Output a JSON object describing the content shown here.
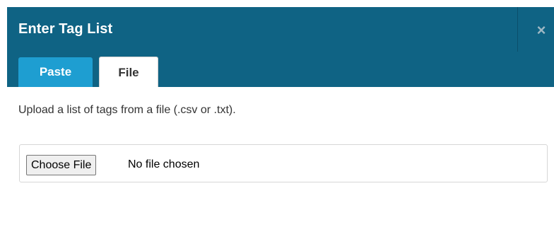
{
  "dialog": {
    "title": "Enter Tag List",
    "close_icon": "×",
    "colors": {
      "header": "#0f6384",
      "active_tab": "#1e9ed1"
    }
  },
  "tabs": [
    {
      "label": "Paste"
    },
    {
      "label": "File"
    }
  ],
  "content": {
    "description": "Upload a list of tags from a file (.csv or .txt).",
    "file_input": {
      "button_label": "Choose File",
      "status": "No file chosen"
    }
  }
}
